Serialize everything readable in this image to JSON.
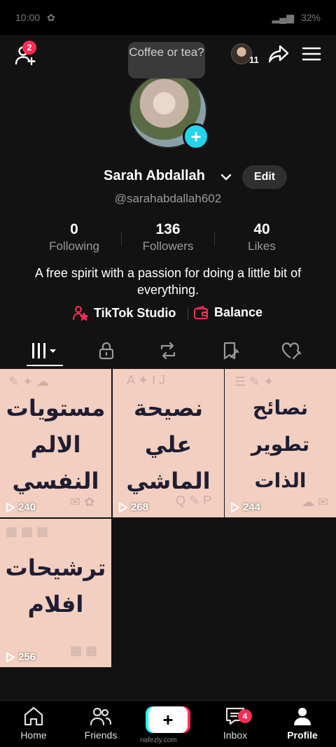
{
  "status_bar": {
    "time": "10:00",
    "battery": "32%"
  },
  "top_bar": {
    "add_friends_badge": "2",
    "visitors_count": "11"
  },
  "profile": {
    "note_text": "Coffee or tea?",
    "display_name": "Sarah Abdallah",
    "edit_label": "Edit",
    "username": "@sarahabdallah602",
    "stats": [
      {
        "value": "0",
        "label": "Following"
      },
      {
        "value": "136",
        "label": "Followers"
      },
      {
        "value": "40",
        "label": "Likes"
      }
    ],
    "bio": "A free spirit with a passion for doing a little bit of everything.",
    "tools": [
      {
        "label": "TikTok Studio",
        "icon": "studio-icon"
      },
      {
        "label": "Balance",
        "icon": "wallet-icon"
      }
    ]
  },
  "tabs": [
    "videos-grid-icon",
    "private-lock-icon",
    "reposts-icon",
    "favorites-icon",
    "liked-heart-icon"
  ],
  "videos": [
    {
      "title": "مستويات الالم النفسي",
      "views": "240"
    },
    {
      "title": "نصيحة علي الماشي",
      "views": "268"
    },
    {
      "title": "نصائح تطوير الذات",
      "views": "244"
    },
    {
      "title": "ترشيحات افلام",
      "views": "256"
    }
  ],
  "bottom_nav": {
    "home": "Home",
    "friends": "Friends",
    "inbox": "Inbox",
    "inbox_badge": "4",
    "profile": "Profile"
  },
  "watermark": "nafezly.com",
  "colors": {
    "accent_red": "#fe2c55",
    "accent_cyan": "#20d5ec",
    "tile_bg": "#f2cfc0"
  }
}
